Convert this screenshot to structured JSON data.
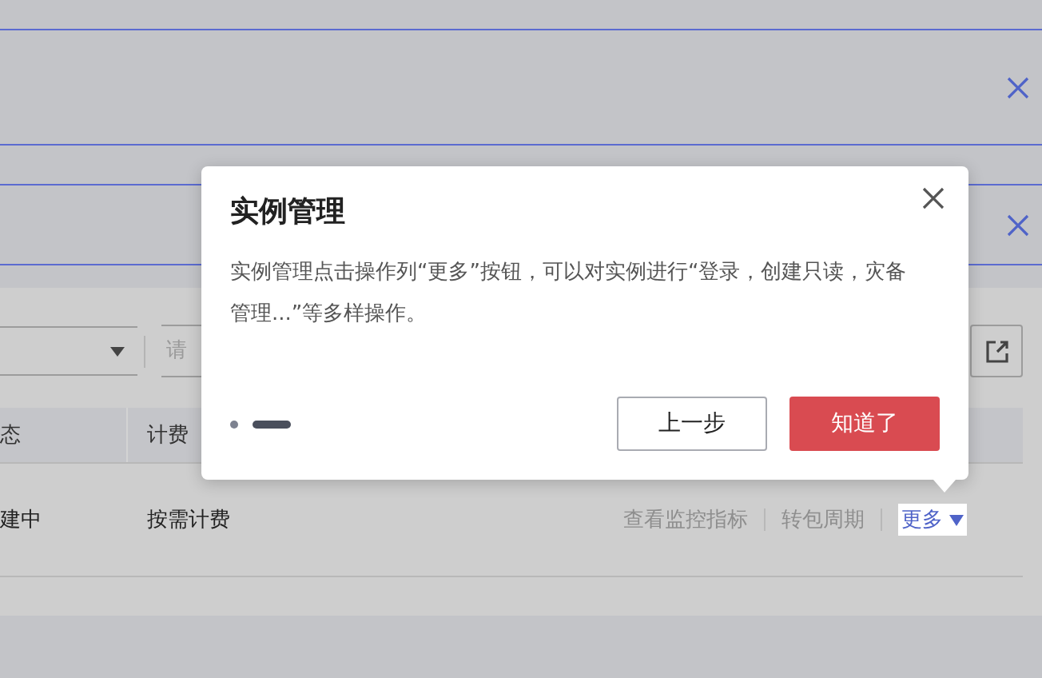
{
  "toolbar": {
    "search_placeholder": "请"
  },
  "table": {
    "columns": [
      "态",
      "计费"
    ],
    "rows": [
      {
        "cells": [
          "建中",
          "按需计费"
        ],
        "actions": [
          "查看监控指标",
          "转包周期"
        ],
        "more": "更多"
      }
    ]
  },
  "guide": {
    "title": "实例管理",
    "body": "实例管理点击操作列“更多”按钮，可以对实例进行“登录，创建只读，灾备管理...”等多样操作。",
    "steps": [
      {
        "selected": false
      },
      {
        "selected": true
      }
    ],
    "prev_button": "上一步",
    "next_button": "知道了"
  }
}
